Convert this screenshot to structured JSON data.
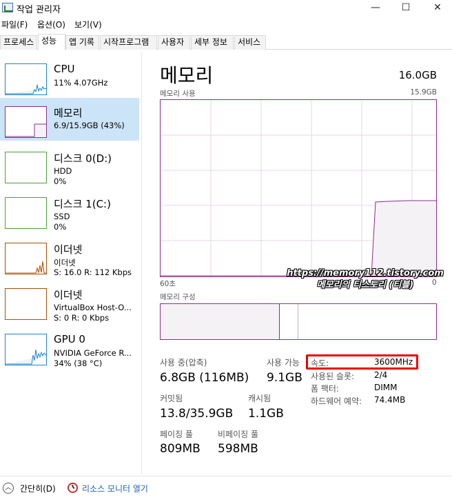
{
  "window": {
    "title": "작업 관리자",
    "minimize": "—",
    "maximize": "☐",
    "close": "✕"
  },
  "menu": [
    "파일(F)",
    "옵션(O)",
    "보기(V)"
  ],
  "tabs": [
    "프로세스",
    "성능",
    "앱 기록",
    "시작프로그램",
    "사용자",
    "세부 정보",
    "서비스"
  ],
  "active_tab": "성능",
  "resources": [
    {
      "name": "CPU",
      "line1": "11% 4.07GHz",
      "line2": "",
      "color": "#1d83c8"
    },
    {
      "name": "메모리",
      "line1": "6.9/15.9GB (43%)",
      "line2": "",
      "color": "#8b2c8f"
    },
    {
      "name": "디스크 0(D:)",
      "line1": "HDD",
      "line2": "0%",
      "color": "#4da133"
    },
    {
      "name": "디스크 1(C:)",
      "line1": "SSD",
      "line2": "0%",
      "color": "#4da133"
    },
    {
      "name": "이더넷",
      "line1": "이더넷",
      "line2": "S: 16.0 R: 112 Kbps",
      "color": "#a74f01"
    },
    {
      "name": "이더넷",
      "line1": "VirtualBox Host-O...",
      "line2": "S: 0 R: 0 Kbps",
      "color": "#a74f01"
    },
    {
      "name": "GPU 0",
      "line1": "NVIDIA GeForce R...",
      "line2": "34% (38 °C)",
      "color": "#1d83c8"
    }
  ],
  "memory": {
    "title": "메모리",
    "total": "16.0GB",
    "usage_label": "메모리 사용",
    "usage_max": "15.9GB",
    "time_left": "60초",
    "time_right": "0",
    "composition_label": "메모리 구성",
    "stats": {
      "in_use_label": "사용 중(압축)",
      "in_use_value": "6.8GB (116MB)",
      "available_label": "사용 가능",
      "available_value": "9.1GB",
      "committed_label": "커밋됨",
      "committed_value": "13.8/35.9GB",
      "cached_label": "캐시됨",
      "cached_value": "1.1GB",
      "paged_label": "페이징 풀",
      "paged_value": "809MB",
      "nonpaged_label": "비페이징 풀",
      "nonpaged_value": "598MB"
    },
    "details": [
      {
        "label": "속도:",
        "value": "3600MHz"
      },
      {
        "label": "사용된 슬롯:",
        "value": "2/4"
      },
      {
        "label": "폼 팩터:",
        "value": "DIMM"
      },
      {
        "label": "하드웨어 예약:",
        "value": "74.4MB"
      }
    ]
  },
  "watermark": {
    "line1": "https://memory112.tistory.com",
    "line2": "메모리의 티스토리 (티블)"
  },
  "footer": {
    "collapse": "간단히(D)",
    "resource_monitor": "리소스 모니터 열기"
  },
  "colors": {
    "memory": "#8b2c8f",
    "memory_fill": "#f4f2f4",
    "selected_bg": "#cce4f7",
    "highlight": "#e00000"
  }
}
